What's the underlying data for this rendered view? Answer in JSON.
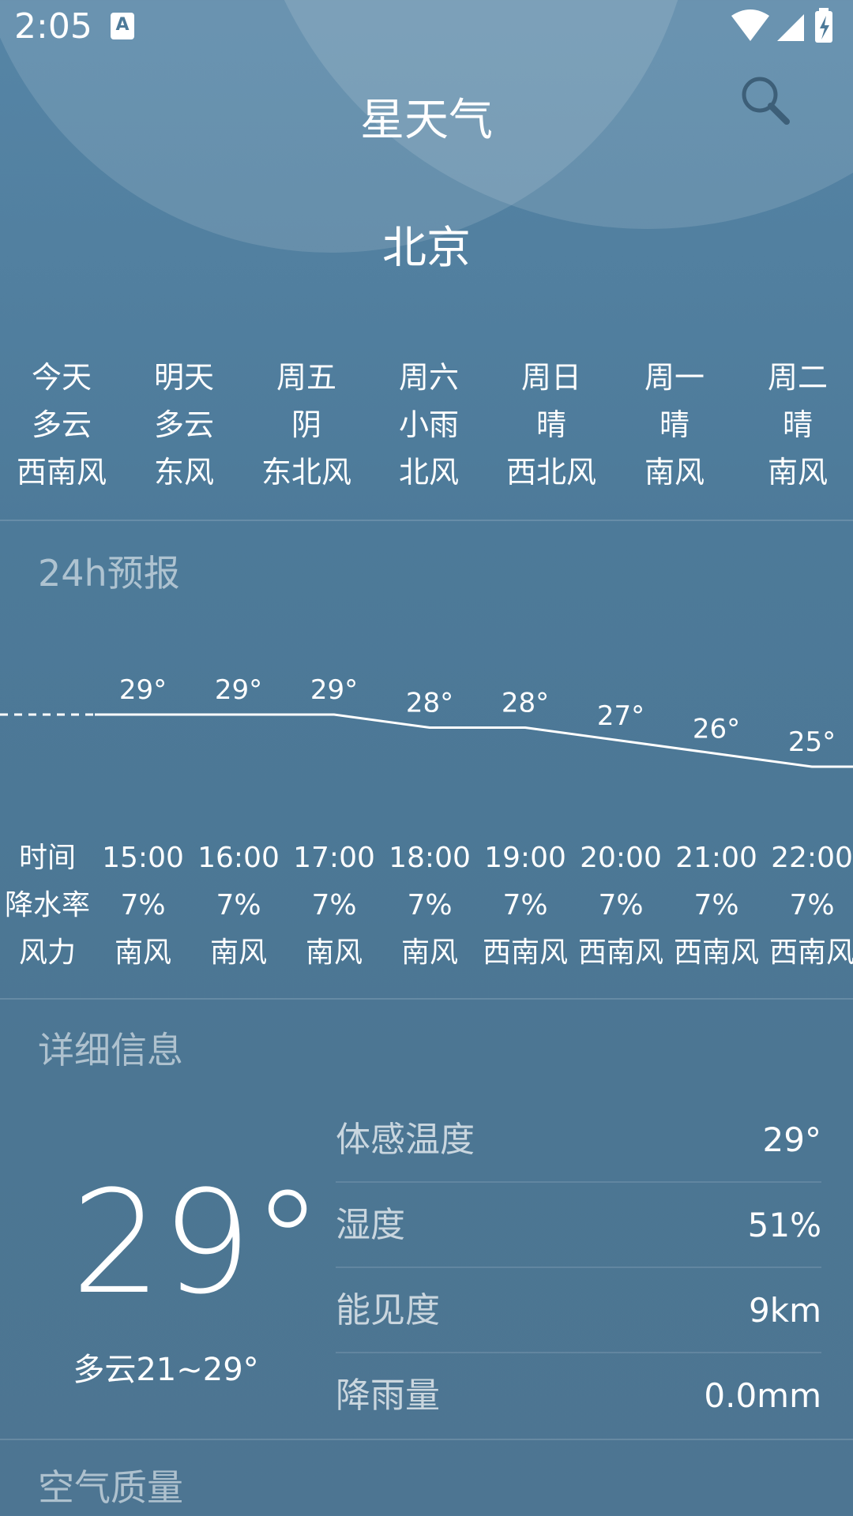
{
  "status_bar": {
    "time": "2:05",
    "a_badge": "A"
  },
  "app_title": "星天气",
  "city": "北京",
  "forecast": [
    {
      "day": "今天",
      "weather": "多云",
      "wind": "西南风"
    },
    {
      "day": "明天",
      "weather": "多云",
      "wind": "东风"
    },
    {
      "day": "周五",
      "weather": "阴",
      "wind": "东北风"
    },
    {
      "day": "周六",
      "weather": "小雨",
      "wind": "北风"
    },
    {
      "day": "周日",
      "weather": "晴",
      "wind": "西北风"
    },
    {
      "day": "周一",
      "weather": "晴",
      "wind": "南风"
    },
    {
      "day": "周二",
      "weather": "晴",
      "wind": "南风"
    }
  ],
  "hourly": {
    "title": "24h预报",
    "labels": {
      "time": "时间",
      "precip": "降水率",
      "wind": "风力"
    },
    "hours": [
      {
        "time": "15:00",
        "temp": "29°",
        "precip": "7%",
        "wind": "南风"
      },
      {
        "time": "16:00",
        "temp": "29°",
        "precip": "7%",
        "wind": "南风"
      },
      {
        "time": "17:00",
        "temp": "29°",
        "precip": "7%",
        "wind": "南风"
      },
      {
        "time": "18:00",
        "temp": "28°",
        "precip": "7%",
        "wind": "南风"
      },
      {
        "time": "19:00",
        "temp": "28°",
        "precip": "7%",
        "wind": "西南风"
      },
      {
        "time": "20:00",
        "temp": "27°",
        "precip": "7%",
        "wind": "西南风"
      },
      {
        "time": "21:00",
        "temp": "26°",
        "precip": "7%",
        "wind": "西南风"
      },
      {
        "time": "22:00",
        "temp": "25°",
        "precip": "7%",
        "wind": "西南风"
      }
    ]
  },
  "details": {
    "title": "详细信息",
    "current_temp": "29°",
    "today_range": "多云21~29°",
    "rows": [
      {
        "label": "体感温度",
        "value": "29°"
      },
      {
        "label": "湿度",
        "value": "51%"
      },
      {
        "label": "能见度",
        "value": "9km"
      },
      {
        "label": "降雨量",
        "value": "0.0mm"
      }
    ]
  },
  "air_quality": {
    "title": "空气质量"
  }
}
